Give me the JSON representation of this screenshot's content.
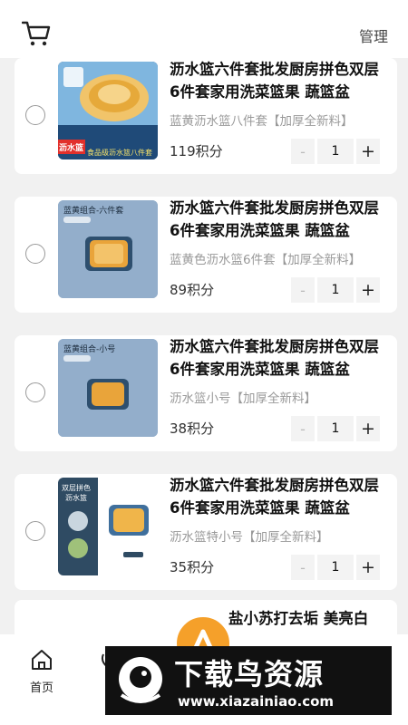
{
  "header": {
    "manage_label": "管理"
  },
  "cart_items": [
    {
      "title": "沥水篮六件套批发厨房拼色双层6件套家用洗菜篮果 蔬篮盆",
      "spec": "蓝黄沥水篮八件套【加厚全新料】",
      "price": "119积分",
      "quantity": "1",
      "image_text": [
        "沥水篮",
        "食品级沥水篮八件套"
      ]
    },
    {
      "title": "沥水篮六件套批发厨房拼色双层6件套家用洗菜篮果 蔬篮盆",
      "spec": "蓝黄色沥水篮6件套【加厚全新料】",
      "price": "89积分",
      "quantity": "1",
      "image_text": [
        "蓝黄组合-六件套"
      ]
    },
    {
      "title": "沥水篮六件套批发厨房拼色双层6件套家用洗菜篮果 蔬篮盆",
      "spec": "沥水篮小号【加厚全新料】",
      "price": "38积分",
      "quantity": "1",
      "image_text": [
        "蓝黄组合-小号"
      ]
    },
    {
      "title": "沥水篮六件套批发厨房拼色双层6件套家用洗菜篮果 蔬篮盆",
      "spec": "沥水篮特小号【加厚全新料】",
      "price": "35积分",
      "quantity": "1",
      "image_text": [
        "双层拼色",
        "沥水篮"
      ]
    },
    {
      "title": "盐小苏打去垢 美亮白"
    }
  ],
  "stepper": {
    "minus": "-",
    "plus": "+"
  },
  "tabbar": {
    "home_label": "首页"
  },
  "watermark": {
    "title": "下载鸟资源",
    "url": "www.xiazainiao.com"
  },
  "colors": {
    "accent": "#f5a02a",
    "card_bg": "#ffffff",
    "page_bg": "#f1f1f1",
    "thumb_blue": "#93aecb"
  }
}
